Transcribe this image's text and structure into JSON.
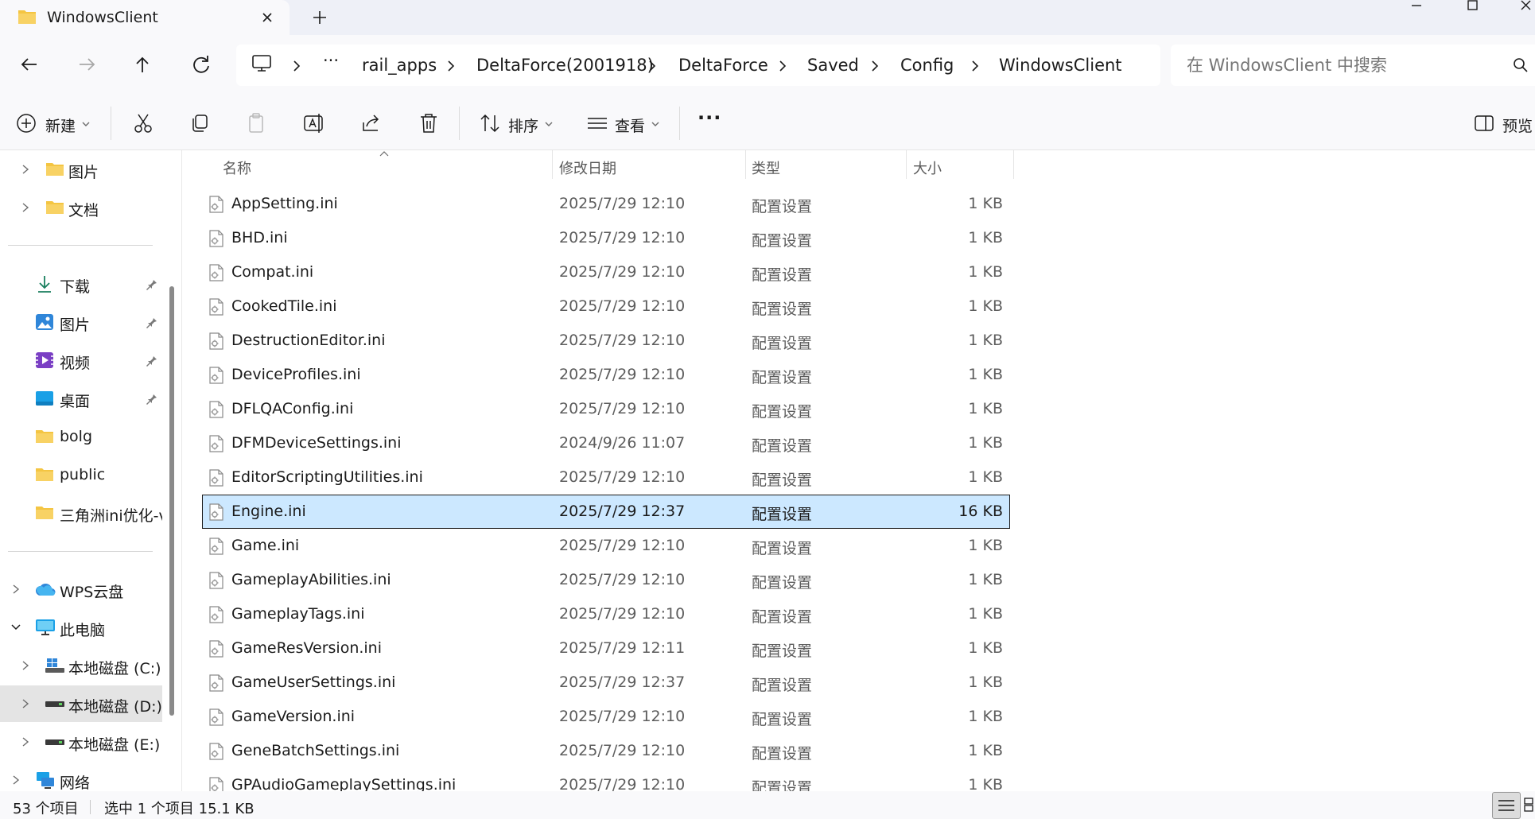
{
  "window": {
    "tab_title": "WindowsClient",
    "colors": {
      "accent": "#0067c0",
      "selection": "#cce8ff",
      "folder": "#f4c542"
    }
  },
  "address": {
    "crumbs": [
      "rail_apps",
      "DeltaForce(2001918)",
      "DeltaForce",
      "Saved",
      "Config",
      "WindowsClient"
    ],
    "ellipsis": "···"
  },
  "search": {
    "placeholder": "在 WindowsClient 中搜索"
  },
  "toolbar": {
    "new_label": "新建",
    "sort_label": "排序",
    "view_label": "查看",
    "more_label": "···",
    "preview_label": "预览"
  },
  "sidebar": {
    "top_items": [
      {
        "label": "图片",
        "icon": "folder-icon"
      },
      {
        "label": "文档",
        "icon": "folder-icon"
      }
    ],
    "quick_access": [
      {
        "label": "下载",
        "icon": "download-icon",
        "pinned": true
      },
      {
        "label": "图片",
        "icon": "pictures-icon",
        "pinned": true
      },
      {
        "label": "视频",
        "icon": "video-icon",
        "pinned": true
      },
      {
        "label": "桌面",
        "icon": "desktop-icon",
        "pinned": true
      },
      {
        "label": "bolg",
        "icon": "folder-icon",
        "pinned": false
      },
      {
        "label": "public",
        "icon": "folder-icon",
        "pinned": false
      },
      {
        "label": "三角洲ini优化-v",
        "icon": "folder-icon",
        "pinned": false
      }
    ],
    "locations": [
      {
        "label": "WPS云盘",
        "icon": "cloud-icon",
        "indent": 0
      },
      {
        "label": "此电脑",
        "icon": "computer-icon",
        "indent": 0,
        "expanded": true
      },
      {
        "label": "本地磁盘 (C:)",
        "icon": "drive-icon",
        "indent": 1
      },
      {
        "label": "本地磁盘 (D:)",
        "icon": "drive-icon",
        "indent": 1,
        "selected": true
      },
      {
        "label": "本地磁盘 (E:)",
        "icon": "drive-icon",
        "indent": 1
      },
      {
        "label": "网络",
        "icon": "network-icon",
        "indent": 0
      }
    ]
  },
  "columns": {
    "name": "名称",
    "date": "修改日期",
    "type": "类型",
    "size": "大小"
  },
  "files": [
    {
      "name": "AppSetting.ini",
      "date": "2025/7/29 12:10",
      "type": "配置设置",
      "size": "1 KB"
    },
    {
      "name": "BHD.ini",
      "date": "2025/7/29 12:10",
      "type": "配置设置",
      "size": "1 KB"
    },
    {
      "name": "Compat.ini",
      "date": "2025/7/29 12:10",
      "type": "配置设置",
      "size": "1 KB"
    },
    {
      "name": "CookedTile.ini",
      "date": "2025/7/29 12:10",
      "type": "配置设置",
      "size": "1 KB"
    },
    {
      "name": "DestructionEditor.ini",
      "date": "2025/7/29 12:10",
      "type": "配置设置",
      "size": "1 KB"
    },
    {
      "name": "DeviceProfiles.ini",
      "date": "2025/7/29 12:10",
      "type": "配置设置",
      "size": "1 KB"
    },
    {
      "name": "DFLQAConfig.ini",
      "date": "2025/7/29 12:10",
      "type": "配置设置",
      "size": "1 KB"
    },
    {
      "name": "DFMDeviceSettings.ini",
      "date": "2024/9/26 11:07",
      "type": "配置设置",
      "size": "1 KB"
    },
    {
      "name": "EditorScriptingUtilities.ini",
      "date": "2025/7/29 12:10",
      "type": "配置设置",
      "size": "1 KB"
    },
    {
      "name": "Engine.ini",
      "date": "2025/7/29 12:37",
      "type": "配置设置",
      "size": "16 KB",
      "selected": true
    },
    {
      "name": "Game.ini",
      "date": "2025/7/29 12:10",
      "type": "配置设置",
      "size": "1 KB"
    },
    {
      "name": "GameplayAbilities.ini",
      "date": "2025/7/29 12:10",
      "type": "配置设置",
      "size": "1 KB"
    },
    {
      "name": "GameplayTags.ini",
      "date": "2025/7/29 12:10",
      "type": "配置设置",
      "size": "1 KB"
    },
    {
      "name": "GameResVersion.ini",
      "date": "2025/7/29 12:11",
      "type": "配置设置",
      "size": "1 KB"
    },
    {
      "name": "GameUserSettings.ini",
      "date": "2025/7/29 12:37",
      "type": "配置设置",
      "size": "1 KB"
    },
    {
      "name": "GameVersion.ini",
      "date": "2025/7/29 12:10",
      "type": "配置设置",
      "size": "1 KB"
    },
    {
      "name": "GeneBatchSettings.ini",
      "date": "2025/7/29 12:10",
      "type": "配置设置",
      "size": "1 KB"
    },
    {
      "name": "GPAudioGameplaySettings.ini",
      "date": "2025/7/29 12:10",
      "type": "配置设置",
      "size": "1 KB"
    }
  ],
  "status": {
    "item_count": "53 个项目",
    "selection": "选中 1 个项目  15.1 KB"
  }
}
